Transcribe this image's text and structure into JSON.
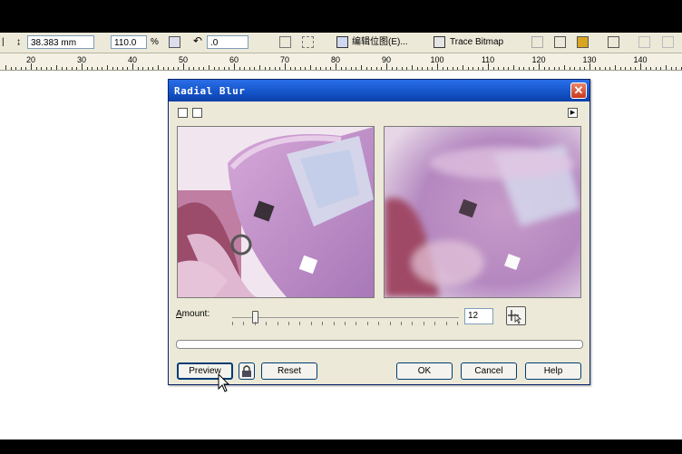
{
  "toolbar": {
    "dimension_value": "38.383 mm",
    "scale_value": "110.0",
    "scale_unit": "%",
    "rotation_value": ".0",
    "edit_menu_text": "编辑位图(E)...",
    "trace_bitmap_label": "Trace Bitmap"
  },
  "ruler": {
    "labels": [
      "20",
      "30",
      "40",
      "50",
      "60",
      "70",
      "80",
      "90",
      "100",
      "110",
      "120",
      "130",
      "140"
    ]
  },
  "dialog": {
    "title": "Radial Blur",
    "close_glyph": "✕",
    "amount_label_prefix": "A",
    "amount_label_rest": "mount:",
    "amount_value": "12",
    "amount_slider_value": 12,
    "buttons": {
      "preview": "Preview",
      "reset": "Reset",
      "ok": "OK",
      "cancel": "Cancel",
      "help": "Help"
    }
  },
  "colors": {
    "titlebar": "#1453c7",
    "dialog_bg": "#ece9d8",
    "close_red": "#c8391c"
  }
}
